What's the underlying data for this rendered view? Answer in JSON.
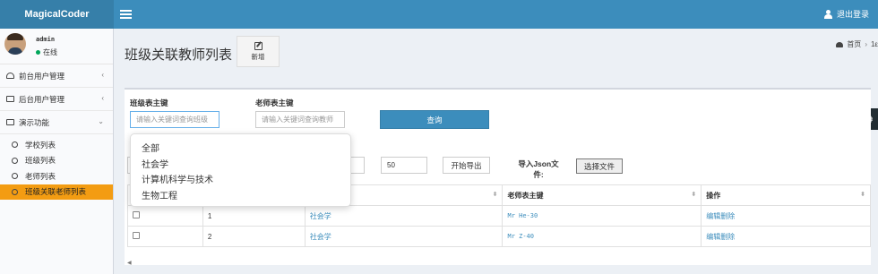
{
  "app": {
    "logo": "MagicalCoder"
  },
  "header": {
    "logout_label": "退出登录"
  },
  "user": {
    "name": "admin",
    "status": "在线",
    "status_color": "#00a65a"
  },
  "sidebar": {
    "items": [
      {
        "label": "前台用户管理",
        "chevron": "‹"
      },
      {
        "label": "后台用户管理",
        "chevron": "‹"
      },
      {
        "label": "演示功能",
        "chevron": "⌄"
      }
    ],
    "subitems": [
      {
        "label": "学校列表"
      },
      {
        "label": "班级列表"
      },
      {
        "label": "老师列表"
      },
      {
        "label": "班级关联老师列表"
      }
    ],
    "active_color": "#f39c12"
  },
  "page": {
    "title": "班级关联教师列表",
    "add_label": "新增"
  },
  "breadcrumb": {
    "home": "首页",
    "next": "1ε"
  },
  "search": {
    "class_key_label": "班级表主键",
    "class_key_placeholder": "请输入关键词查询班级",
    "teacher_key_label": "老师表主键",
    "teacher_key_placeholder": "请输入关键词查询教师",
    "query_label": "查询"
  },
  "export": {
    "count_value": "50",
    "export_label": "开始导出"
  },
  "import": {
    "label": "导入Json文件:",
    "file_button": "选择文件"
  },
  "dropdown": {
    "options": [
      "全部",
      "社会学",
      "计算机科学与技术",
      "生物工程"
    ]
  },
  "table": {
    "headers": [
      "",
      "",
      "",
      "老师表主键",
      "操作"
    ],
    "rows": [
      {
        "index": "1",
        "class_name": "社会学",
        "teacher": "Mr He-30",
        "actions": "编辑删除"
      },
      {
        "index": "2",
        "class_name": "社会学",
        "teacher": "Mr Z-40",
        "actions": "编辑删除"
      }
    ]
  },
  "colors": {
    "header": "#3c8dbc",
    "logo_bg": "#367fa9",
    "link": "#3c8dbc",
    "primary_button": "#3c8dbc"
  }
}
